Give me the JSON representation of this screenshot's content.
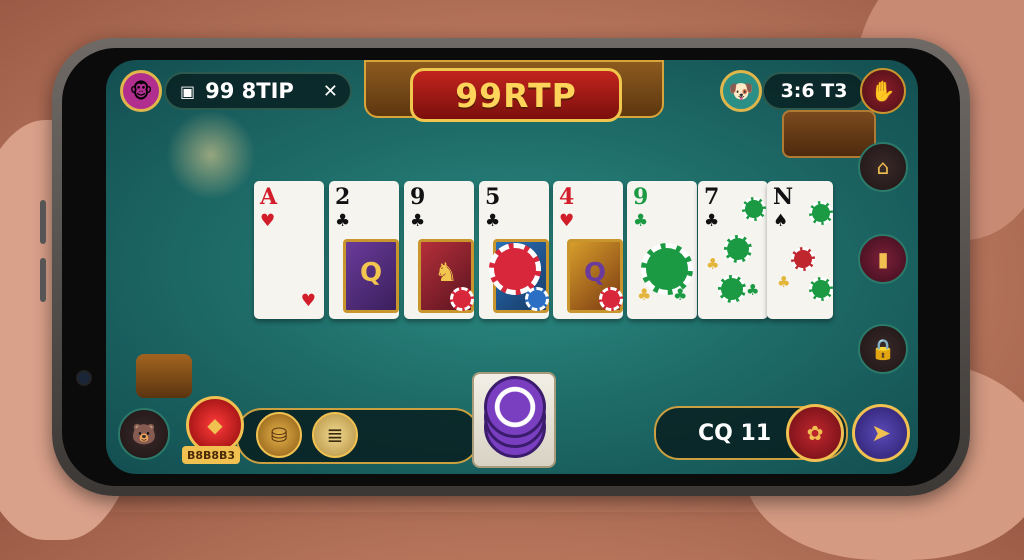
{
  "game": {
    "title": "99RTP"
  },
  "top_left": {
    "avatar_icon": "monkey-avatar-icon",
    "balance_icon": "wallet-icon",
    "balance": "99 8TIP",
    "close_icon": "x-icon"
  },
  "top_right": {
    "avatar_icon": "dog-avatar-icon",
    "score": "3:6 T3",
    "menu_icon": "hand-icon"
  },
  "cards": [
    {
      "rank": "A",
      "suit": "♥",
      "color": "red"
    },
    {
      "rank": "2",
      "suit": "♣",
      "color": "black"
    },
    {
      "rank": "9",
      "suit": "♣",
      "color": "black"
    },
    {
      "rank": "5",
      "suit": "♣",
      "color": "black"
    },
    {
      "rank": "4",
      "suit": "♥",
      "color": "red"
    },
    {
      "rank": "9",
      "suit": "♣",
      "color": "green"
    },
    {
      "rank": "7",
      "suit": "♣",
      "color": "black"
    },
    {
      "rank": "N",
      "suit": "♠",
      "color": "black"
    }
  ],
  "side_buttons": [
    "house-icon",
    "door-icon",
    "lock-icon"
  ],
  "bottom_left": {
    "label": "B8B8B3",
    "buttons": [
      "bear-icon",
      "red-gem-icon",
      "treasure-chest-icon",
      "scroll-icon"
    ]
  },
  "bet": {
    "value": "CQ 11",
    "action_icon": "lips-icon",
    "next_icon": "play-arrow-icon"
  },
  "colors": {
    "felt": "#1f6e6a",
    "gold": "#e0b54a",
    "title_red": "#c2241e"
  }
}
